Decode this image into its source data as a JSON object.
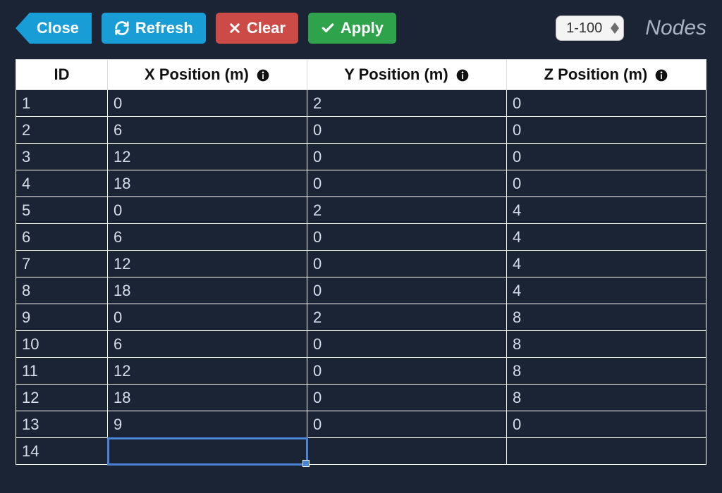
{
  "toolbar": {
    "close_label": "Close",
    "refresh_label": "Refresh",
    "clear_label": "Clear",
    "apply_label": "Apply",
    "range_label": "1-100"
  },
  "panel": {
    "title": "Nodes"
  },
  "table": {
    "headers": {
      "id": "ID",
      "x": "X Position (m)",
      "y": "Y Position (m)",
      "z": "Z Position (m)"
    },
    "rows": [
      {
        "id": "1",
        "x": "0",
        "y": "2",
        "z": "0"
      },
      {
        "id": "2",
        "x": "6",
        "y": "0",
        "z": "0"
      },
      {
        "id": "3",
        "x": "12",
        "y": "0",
        "z": "0"
      },
      {
        "id": "4",
        "x": "18",
        "y": "0",
        "z": "0"
      },
      {
        "id": "5",
        "x": "0",
        "y": "2",
        "z": "4"
      },
      {
        "id": "6",
        "x": "6",
        "y": "0",
        "z": "4"
      },
      {
        "id": "7",
        "x": "12",
        "y": "0",
        "z": "4"
      },
      {
        "id": "8",
        "x": "18",
        "y": "0",
        "z": "4"
      },
      {
        "id": "9",
        "x": "0",
        "y": "2",
        "z": "8"
      },
      {
        "id": "10",
        "x": "6",
        "y": "0",
        "z": "8"
      },
      {
        "id": "11",
        "x": "12",
        "y": "0",
        "z": "8"
      },
      {
        "id": "12",
        "x": "18",
        "y": "0",
        "z": "8"
      },
      {
        "id": "13",
        "x": "9",
        "y": "0",
        "z": "0"
      },
      {
        "id": "14",
        "x": "",
        "y": "",
        "z": "",
        "editing_col": "x"
      }
    ]
  }
}
